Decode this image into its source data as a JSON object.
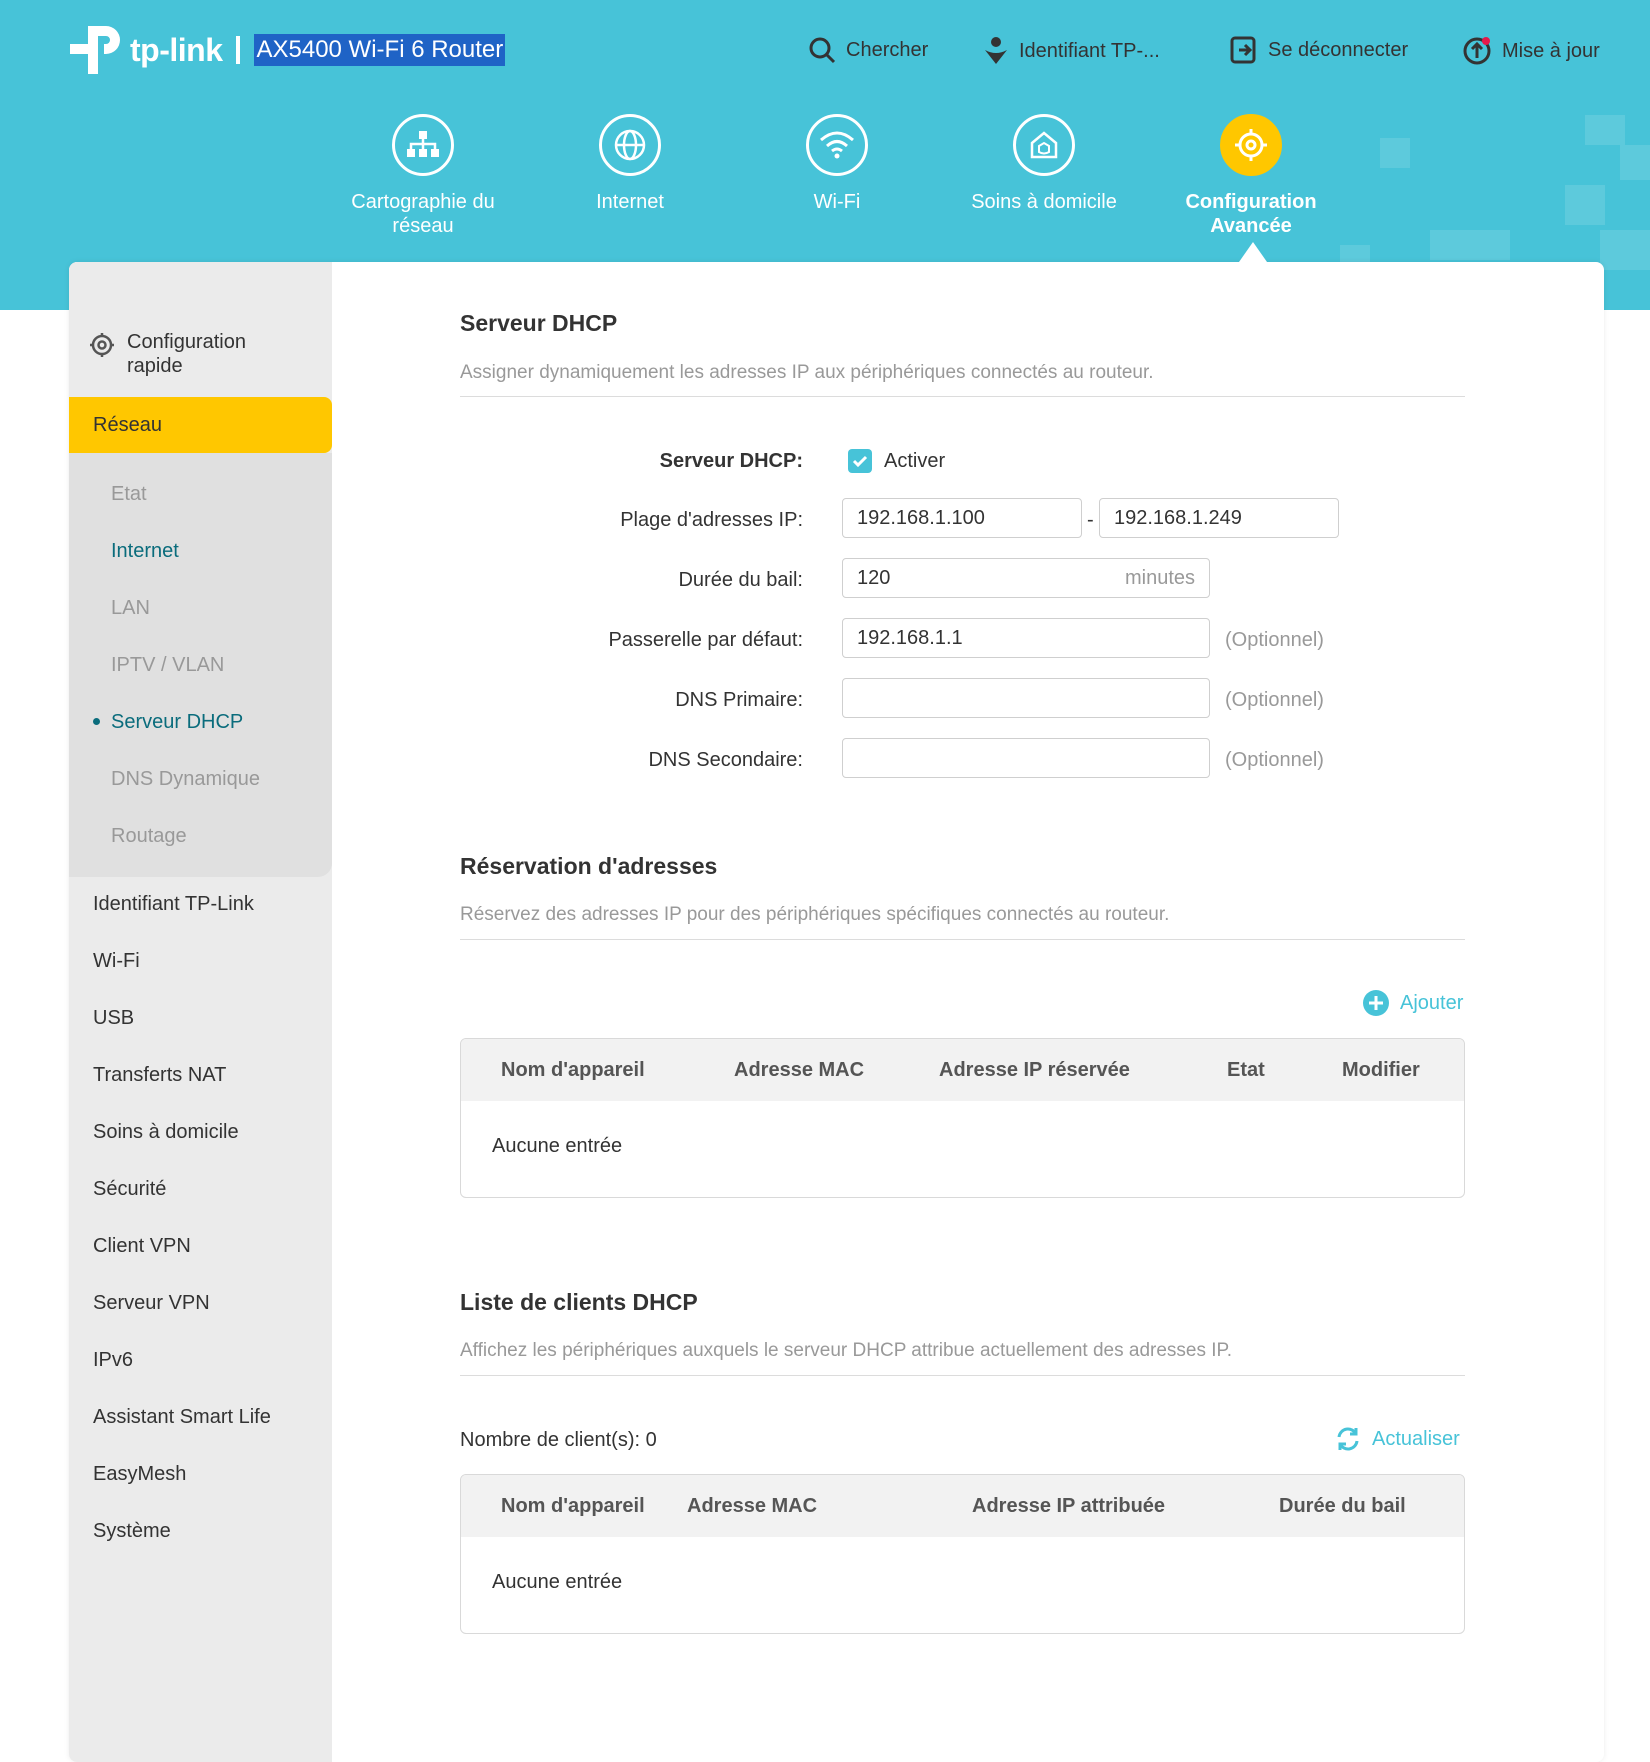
{
  "brand": {
    "logo_text": "tp-link",
    "model": "AX5400 Wi-Fi 6 Router"
  },
  "topnav": {
    "search": "Chercher",
    "tplink_id": "Identifiant TP-...",
    "logout": "Se déconnecter",
    "update": "Mise à jour"
  },
  "mainnav": [
    {
      "label": "Cartographie du réseau",
      "icon": "network-map-icon"
    },
    {
      "label": "Internet",
      "icon": "globe-icon"
    },
    {
      "label": "Wi-Fi",
      "icon": "wifi-icon"
    },
    {
      "label": "Soins à domicile",
      "icon": "home-shield-icon"
    },
    {
      "label": "Configuration Avancée",
      "icon": "gear-icon",
      "active": true
    }
  ],
  "sidebar": {
    "quick_setup": "Configuration rapide",
    "active_section": "Réseau",
    "sub_items": [
      "Etat",
      "Internet",
      "LAN",
      "IPTV / VLAN",
      "Serveur DHCP",
      "DNS Dynamique",
      "Routage"
    ],
    "items": [
      "Identifiant TP-Link",
      "Wi-Fi",
      "USB",
      "Transferts NAT",
      "Soins à domicile",
      "Sécurité",
      "Client VPN",
      "Serveur VPN",
      "IPv6",
      "Assistant Smart Life",
      "EasyMesh",
      "Système"
    ]
  },
  "dhcp": {
    "title": "Serveur DHCP",
    "desc": "Assigner dynamiquement les adresses IP aux périphériques connectés au routeur.",
    "enable_label": "Serveur DHCP:",
    "enable_text": "Activer",
    "enabled": true,
    "range_label": "Plage d'adresses IP:",
    "range_start": "192.168.1.100",
    "range_sep": "-",
    "range_end": "192.168.1.249",
    "lease_label": "Durée du bail:",
    "lease_value": "120",
    "lease_unit": "minutes",
    "gateway_label": "Passerelle par défaut:",
    "gateway_value": "192.168.1.1",
    "dns1_label": "DNS Primaire:",
    "dns1_value": "",
    "dns2_label": "DNS Secondaire:",
    "dns2_value": "",
    "optional": "(Optionnel)"
  },
  "reservation": {
    "title": "Réservation d'adresses",
    "desc": "Réservez des adresses IP pour des périphériques spécifiques connectés au routeur.",
    "add_label": "Ajouter",
    "columns": [
      "Nom d'appareil",
      "Adresse MAC",
      "Adresse IP réservée",
      "Etat",
      "Modifier"
    ],
    "empty": "Aucune entrée"
  },
  "clients": {
    "title": "Liste de clients DHCP",
    "desc": "Affichez les périphériques auxquels le serveur DHCP attribue actuellement des adresses IP.",
    "count_label": "Nombre de client(s): 0",
    "refresh_label": "Actualiser",
    "columns": [
      "Nom d'appareil",
      "Adresse MAC",
      "Adresse IP attribuée",
      "Durée du bail"
    ],
    "empty": "Aucune entrée"
  },
  "colors": {
    "accent": "#47c3d8",
    "highlight": "#ffc700",
    "dark_teal": "#0a6c7c"
  }
}
